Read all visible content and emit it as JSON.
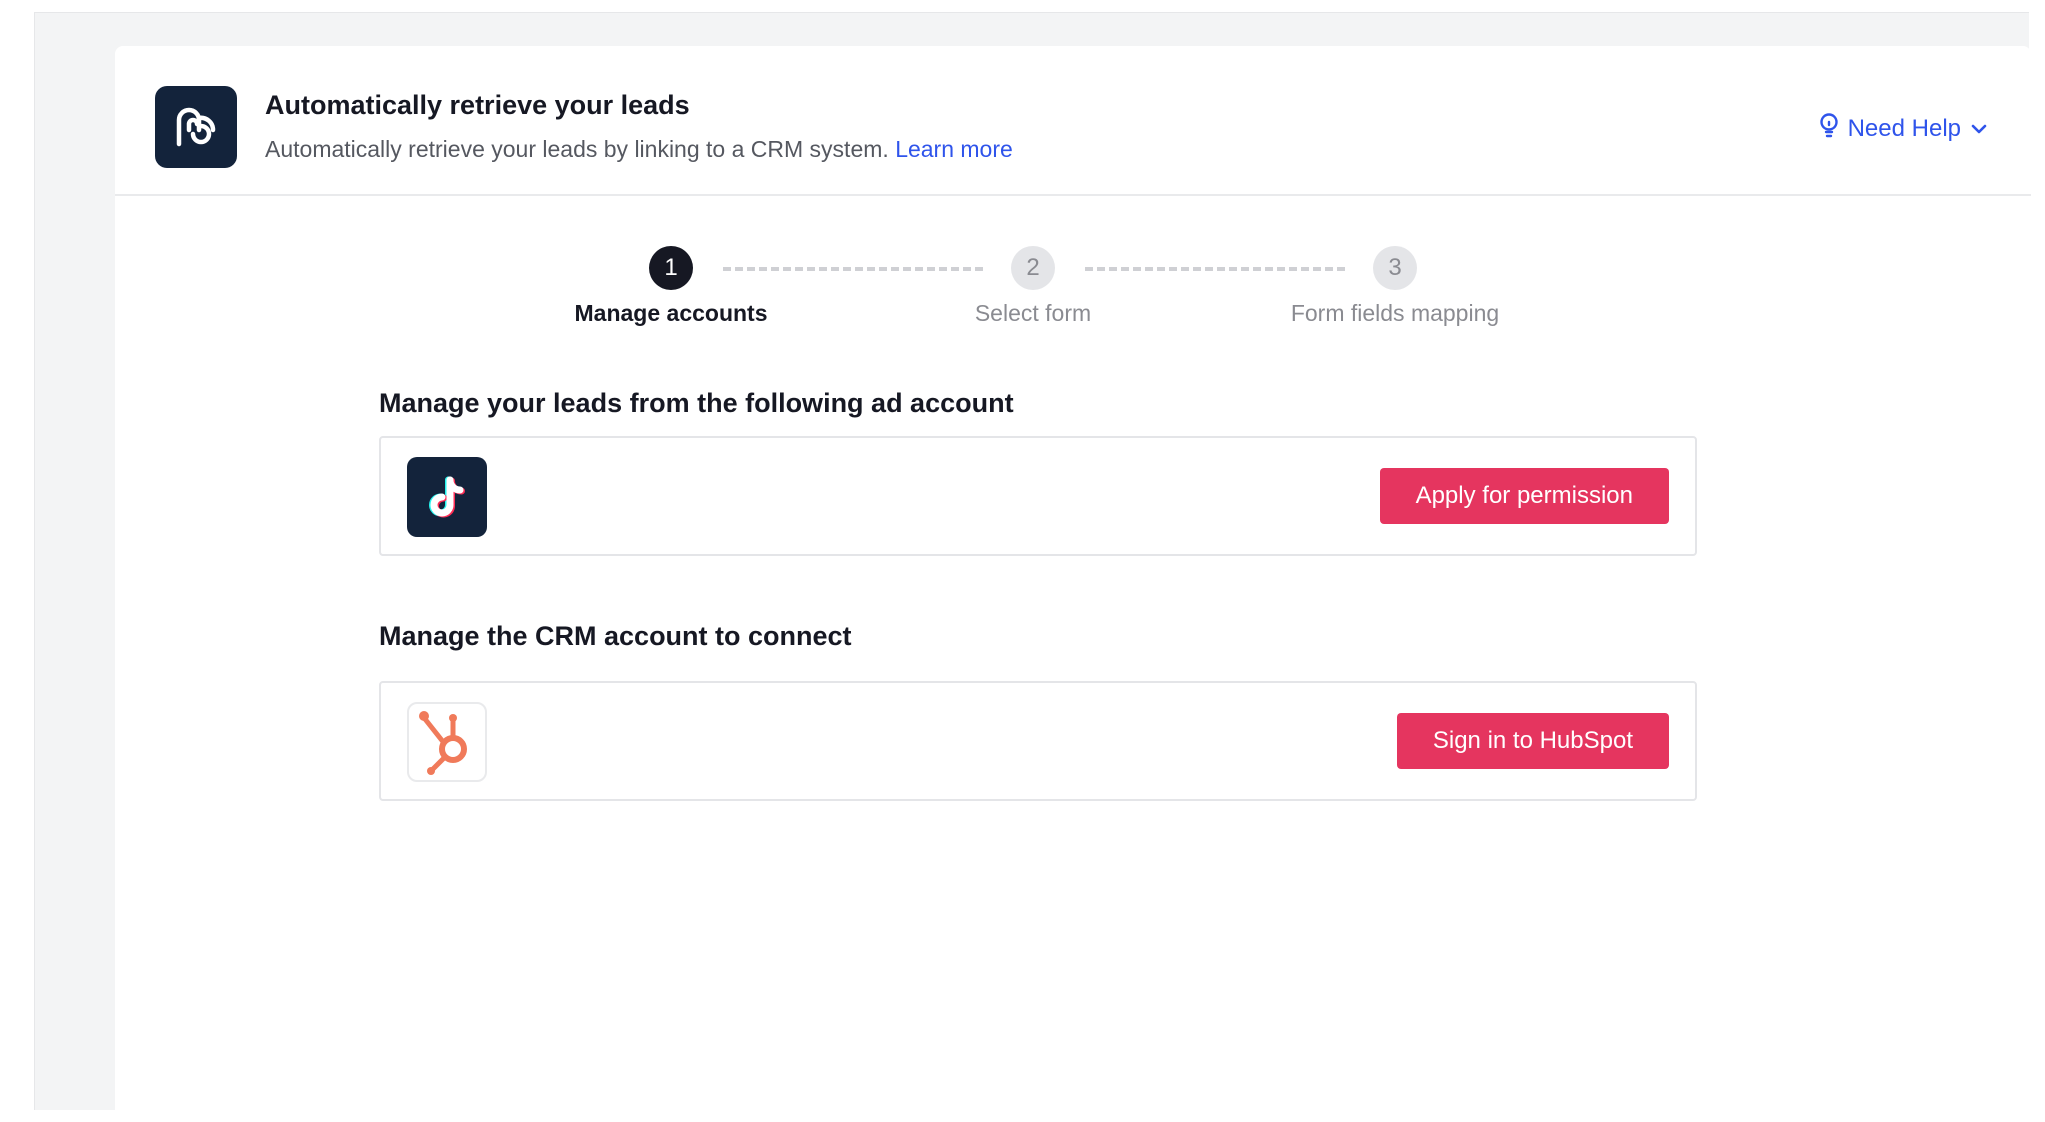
{
  "header": {
    "title": "Automatically retrieve your leads",
    "subtitle": "Automatically retrieve your leads by linking to a CRM system.",
    "learn_more": "Learn more",
    "need_help": "Need Help"
  },
  "steps": [
    {
      "number": "1",
      "label": "Manage accounts",
      "state": "active"
    },
    {
      "number": "2",
      "label": "Select form",
      "state": "inactive"
    },
    {
      "number": "3",
      "label": "Form fields mapping",
      "state": "inactive"
    }
  ],
  "ad_section": {
    "title": "Manage your leads from the following ad account",
    "icon": "tiktok-logo-icon",
    "button": "Apply for permission"
  },
  "crm_section": {
    "title": "Manage the CRM account to connect",
    "icon": "hubspot-logo-icon",
    "button": "Sign in to HubSpot"
  },
  "colors": {
    "primary_button": "#e5355f",
    "link": "#2f54eb",
    "logo_bg": "#13233b",
    "hubspot": "#f07a5a"
  }
}
